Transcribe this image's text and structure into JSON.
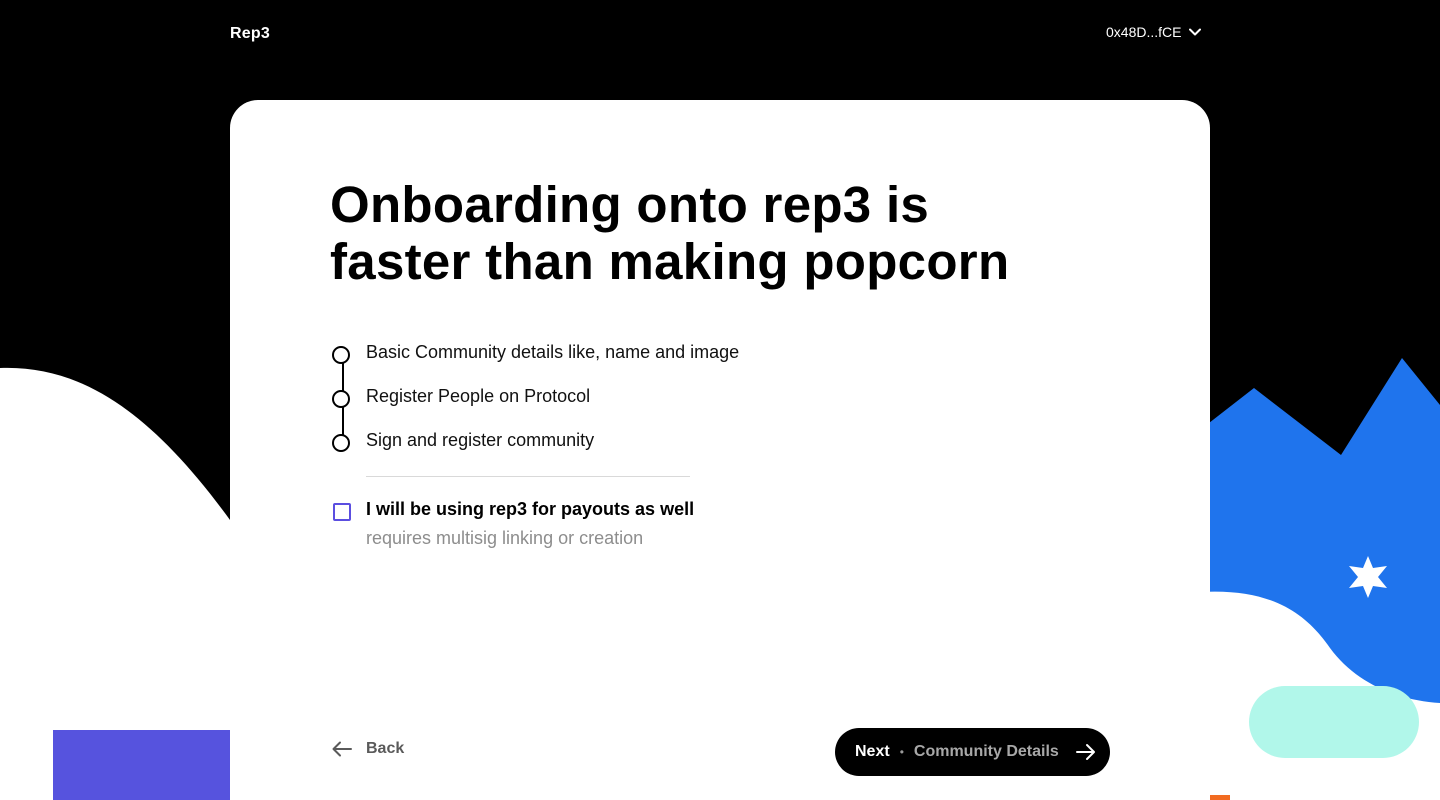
{
  "app": {
    "logo": "Rep3",
    "wallet_address": "0x48D...fCE"
  },
  "main": {
    "headline": "Onboarding onto rep3 is\nfaster than making popcorn",
    "steps": [
      {
        "label": "Basic Community details like, name and image"
      },
      {
        "label": "Register People on Protocol"
      },
      {
        "label": "Sign and register community"
      }
    ],
    "payout_option": {
      "checked": false,
      "title": "I will be using rep3 for payouts as well",
      "subtitle": "requires multisig linking or creation"
    }
  },
  "footer": {
    "back_label": "Back",
    "next_label": "Next",
    "next_separator": "•",
    "next_step_label": "Community Details"
  },
  "colors": {
    "background": "#000000",
    "card": "#ffffff",
    "accent_blue": "#1f74ed",
    "accent_purple": "#5653de",
    "accent_mint": "#b1f7ea",
    "checkbox_border": "#5b4ee0"
  }
}
